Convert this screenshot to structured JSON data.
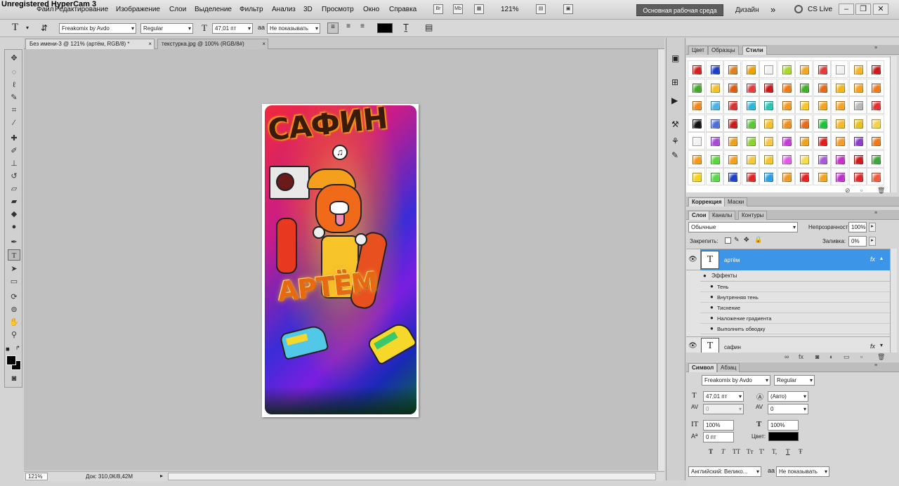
{
  "watermark": "Unregistered HyperCam 3",
  "menu": [
    "Файл",
    "Редактирование",
    "Изображение",
    "Слои",
    "Выделение",
    "Фильтр",
    "Анализ",
    "3D",
    "Просмотр",
    "Окно",
    "Справка"
  ],
  "menubar": {
    "br": "Br",
    "mb": "Mb",
    "zoom": "121%",
    "workspace": "Основная рабочая среда",
    "design": "Дизайн",
    "more": "»",
    "cslive": "CS Live",
    "minimize": "–",
    "restore": "❐",
    "close": "✕"
  },
  "options": {
    "font_family": "Freakomix by Avdo",
    "font_style": "Regular",
    "font_size": "47,01 пт",
    "aa_icon": "aa",
    "antialias": "Не показывать",
    "color": "#000000"
  },
  "tabs": [
    {
      "label": "Без имени-3 @ 121% (артём, RGB/8) *",
      "close": "×"
    },
    {
      "label": "текстурка.jpg @ 100% (RGB/8#)",
      "close": "×"
    }
  ],
  "status": {
    "zoom": "121%",
    "doc": "Док: 310,0К/8,42М"
  },
  "poster": {
    "title": "САФИН",
    "name": "АРТЁМ"
  },
  "styles_panel": {
    "tabs": [
      "Цвет",
      "Образцы",
      "Стили"
    ],
    "swatch_colors": [
      "#d42020",
      "#1d3fc9",
      "#e0801d",
      "#f0a000",
      "#f2f2f2",
      "#a8d82c",
      "#f5a623",
      "#e23b3b",
      "#f0f0f0",
      "#f7b529",
      "#d01818",
      "#46a82a",
      "#f5c02a",
      "#e05c14",
      "#e63c3c",
      "#c81c1c",
      "#f07a1a",
      "#3fb02c",
      "#e86a18",
      "#f5b51c",
      "#f7a21e",
      "#f07a20",
      "#f08a1c",
      "#4ab4e8",
      "#d83232",
      "#2cb8d8",
      "#2cc4b4",
      "#f29a24",
      "#f7c72a",
      "#f5a21c",
      "#f4a52a",
      "#b8b8b8",
      "#e43030",
      "#111111",
      "#4f6fd8",
      "#c81c1c",
      "#58c838",
      "#f5c02a",
      "#f08e1e",
      "#e86a1c",
      "#1ec438",
      "#f5b92a",
      "#e8c020",
      "#f7d24a",
      "#f2f2f2",
      "#a74ad8",
      "#f0a01c",
      "#8ad42c",
      "#f5c84a",
      "#c53cd8",
      "#f0a21c",
      "#e21c1c",
      "#f59c2a",
      "#8b3cc8",
      "#f07818",
      "#f59a1c",
      "#58d83c",
      "#f5a01e",
      "#f7c83a",
      "#f2c82c",
      "#e05ce8",
      "#f5dc4a",
      "#a65ad8",
      "#c830c8",
      "#d01a1a",
      "#3aa83a",
      "#f7d21a",
      "#5ad84a",
      "#1d3fc9",
      "#e02424",
      "#2c9ee8",
      "#f09a24",
      "#e62020",
      "#f5a21c",
      "#c030d0",
      "#e02a2a",
      "#f05a3a"
    ]
  },
  "correction_tabs": [
    "Коррекция",
    "Маски"
  ],
  "layers_panel": {
    "tabs": [
      "Слои",
      "Каналы",
      "Контуры"
    ],
    "blend": "Обычные",
    "opacity_label": "Непрозрачность:",
    "opacity": "100%",
    "lock_label": "Закрепить:",
    "fill_label": "Заливка:",
    "fill": "0%",
    "layers": [
      {
        "name": "артём",
        "fx": "fx",
        "thumb": "T"
      },
      {
        "name": "сафин",
        "fx": "fx",
        "thumb": "T"
      }
    ],
    "effects_label": "Эффекты",
    "effects": [
      "Тень",
      "Внутренняя тень",
      "Тиснение",
      "Наложение градиента",
      "Выполнить обводку"
    ]
  },
  "char_panel": {
    "tabs": [
      "Символ",
      "Абзац"
    ],
    "font": "Freakomix by Avdo",
    "style": "Regular",
    "size": "47,01 пт",
    "leading": "(Авто)",
    "kerning": "0",
    "tracking": "0",
    "vscale": "100%",
    "hscale": "100%",
    "baseline": "0 пт",
    "color_label": "Цвет:",
    "text_styles": [
      "T",
      "T",
      "TT",
      "Tт",
      "T'",
      "T,",
      "T",
      "Ŧ"
    ],
    "language": "Английский: Велико...",
    "aa_icon": "aa",
    "aa": "Не показывать"
  },
  "colors": {
    "accent": "#3a8fdc",
    "layer_selected": "#3d95e8"
  }
}
